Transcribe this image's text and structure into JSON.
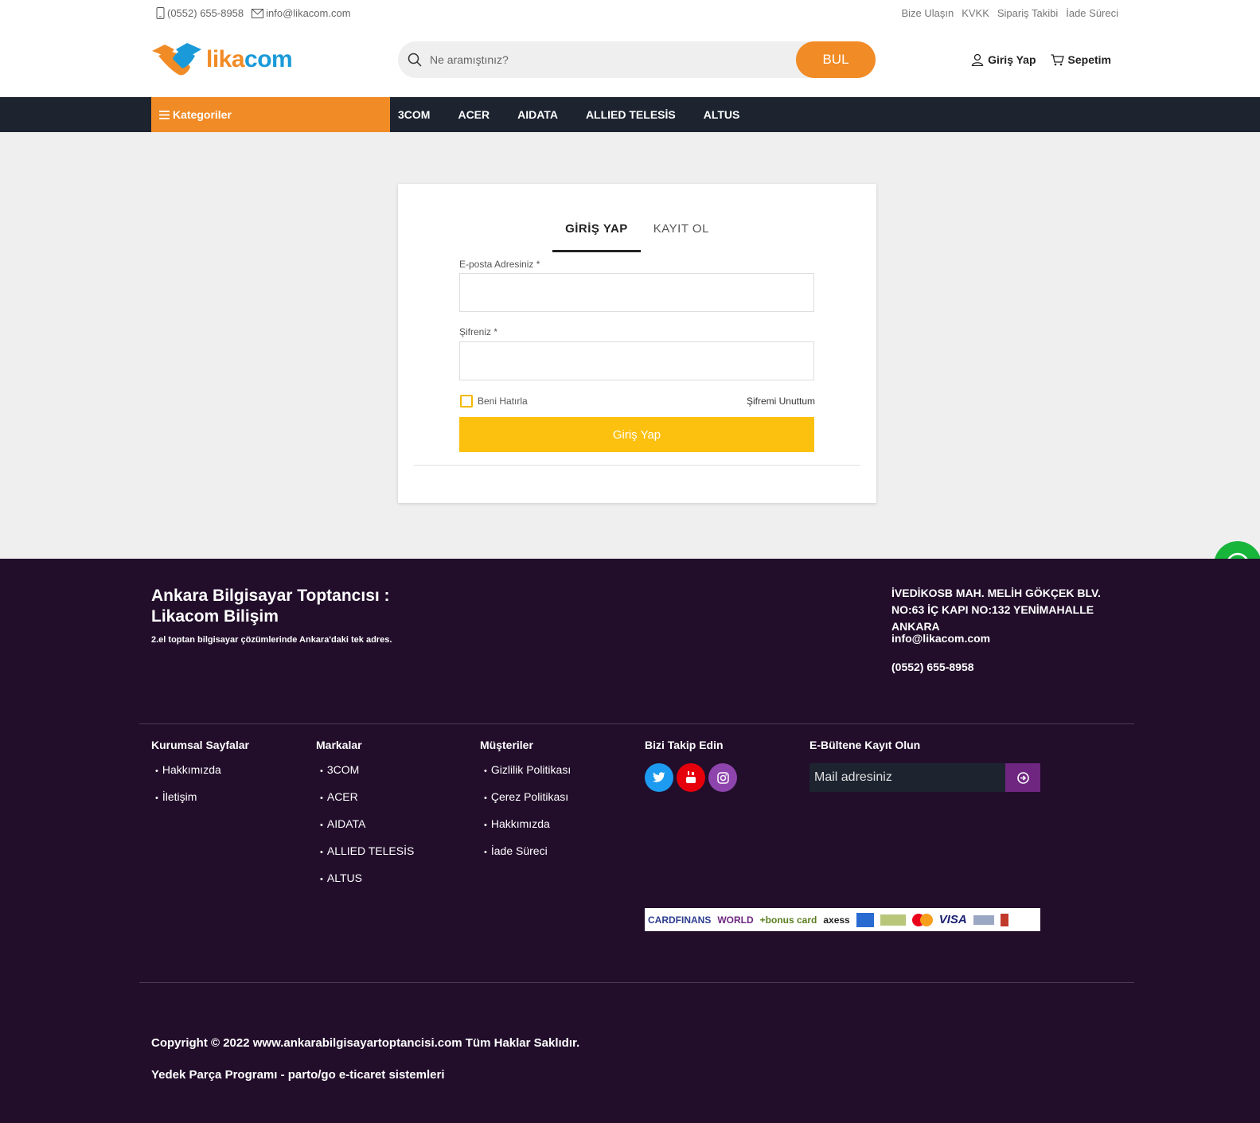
{
  "topbar": {
    "phone": "(0552) 655-8958",
    "email": "info@likacom.com",
    "links": [
      "Bize Ulaşın",
      "KVKK",
      "Sipariş Takibi",
      "İade Süreci"
    ]
  },
  "logo": {
    "part1": "lika",
    "part2": "com"
  },
  "search": {
    "placeholder": "Ne aramıştınız?",
    "button": "BUL"
  },
  "user": {
    "login": "Giriş Yap",
    "cart": "Sepetim"
  },
  "nav": {
    "categories": "Kategoriler",
    "items": [
      "3COM",
      "ACER",
      "AIDATA",
      "ALLIED TELESİS",
      "ALTUS"
    ]
  },
  "login_card": {
    "tabs": [
      "GİRİŞ YAP",
      "KAYIT OL"
    ],
    "email_label": "E-posta Adresiniz *",
    "password_label": "Şifreniz *",
    "remember": "Beni Hatırla",
    "forgot": "Şifremi Unuttum",
    "submit": "Giriş Yap"
  },
  "footer": {
    "title": "Ankara Bilgisayar Toptancısı : Likacom Bilişim",
    "subtitle": "2.el toptan bilgisayar çözümlerinde Ankara'daki tek adres.",
    "address": "İVEDİKOSB MAH. MELİH GÖKÇEK BLV. NO:63 İÇ KAPI NO:132 YENİMAHALLE ANKARA",
    "email": "info@likacom.com",
    "phone": "(0552) 655-8958",
    "col1": {
      "title": "Kurumsal Sayfalar",
      "items": [
        "Hakkımızda",
        "İletişim"
      ]
    },
    "col2": {
      "title": "Markalar",
      "items": [
        "3COM",
        "ACER",
        "AIDATA",
        "ALLIED TELESİS",
        "ALTUS"
      ]
    },
    "col3": {
      "title": "Müşteriler",
      "items": [
        "Gizlilik Politikası",
        "Çerez Politikası",
        "Hakkımızda",
        "İade Süreci"
      ]
    },
    "col4": {
      "title": "Bizi Takip Edin"
    },
    "col5": {
      "title": "E-Bültene Kayıt Olun",
      "placeholder": "Mail adresiniz"
    },
    "payment": [
      "CARDFINANS",
      "WORLD",
      "+bonus card",
      "axess",
      "VISA"
    ],
    "copyright": "Copyright © 2022 www.ankarabilgisayartoptancisi.com Tüm Haklar Saklıdır.",
    "program": "Yedek Parça Programı - parto/go e-ticaret sistemleri"
  },
  "colors": {
    "orange": "#f18b26",
    "yellow": "#fcc00f",
    "nav": "#1d2430",
    "footer": "#220e2b",
    "blue": "#1a9ad9"
  }
}
